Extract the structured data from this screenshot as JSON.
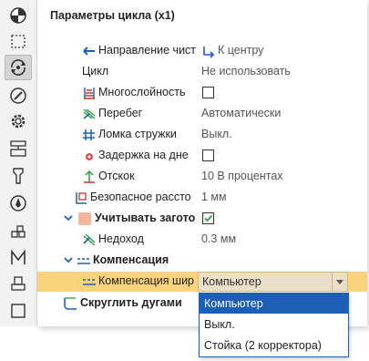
{
  "panel_title": "Параметры цикла (x1)",
  "rows": {
    "direction": {
      "label": "Направление чист",
      "value": "К центру"
    },
    "cycle": {
      "label": "Цикл",
      "value": "Не использовать"
    },
    "multilayer": {
      "label": "Многослойность"
    },
    "overrun": {
      "label": "Перебег",
      "value": "Автоматически"
    },
    "chipbreak": {
      "label": "Ломка стружки",
      "value": "Выкл."
    },
    "dwell": {
      "label": "Задержка на дне"
    },
    "retract": {
      "label": "Отскок",
      "value": "10 В процентах"
    },
    "safe_dist": {
      "label": "Безопасное рассто",
      "value": "1 мм"
    },
    "workpiece": {
      "label": "Учитывать загото"
    },
    "undercut": {
      "label": "Недоход",
      "value": "0.3 мм"
    },
    "compensation": {
      "label": "Компенсация"
    },
    "comp_width": {
      "label": "Компенсация шир",
      "value": "Компьютер"
    },
    "round_arcs": {
      "label": "Скруглить дугами"
    }
  },
  "dropdown_options": [
    "Компьютер",
    "Выкл.",
    "Стойка (2 корректора)"
  ],
  "toolbar_icons": [
    "pie-icon",
    "dashed-rect-icon",
    "rotate-icon",
    "compass-icon",
    "gear-icon",
    "stack-icon",
    "tool-icon",
    "nib-icon",
    "blocks-icon",
    "m-icon",
    "stamp-icon",
    "square-icon"
  ],
  "colors": {
    "selection": "#f9d37c",
    "highlight": "#1c5fb7",
    "accent_blue": "#1f5fb0"
  }
}
